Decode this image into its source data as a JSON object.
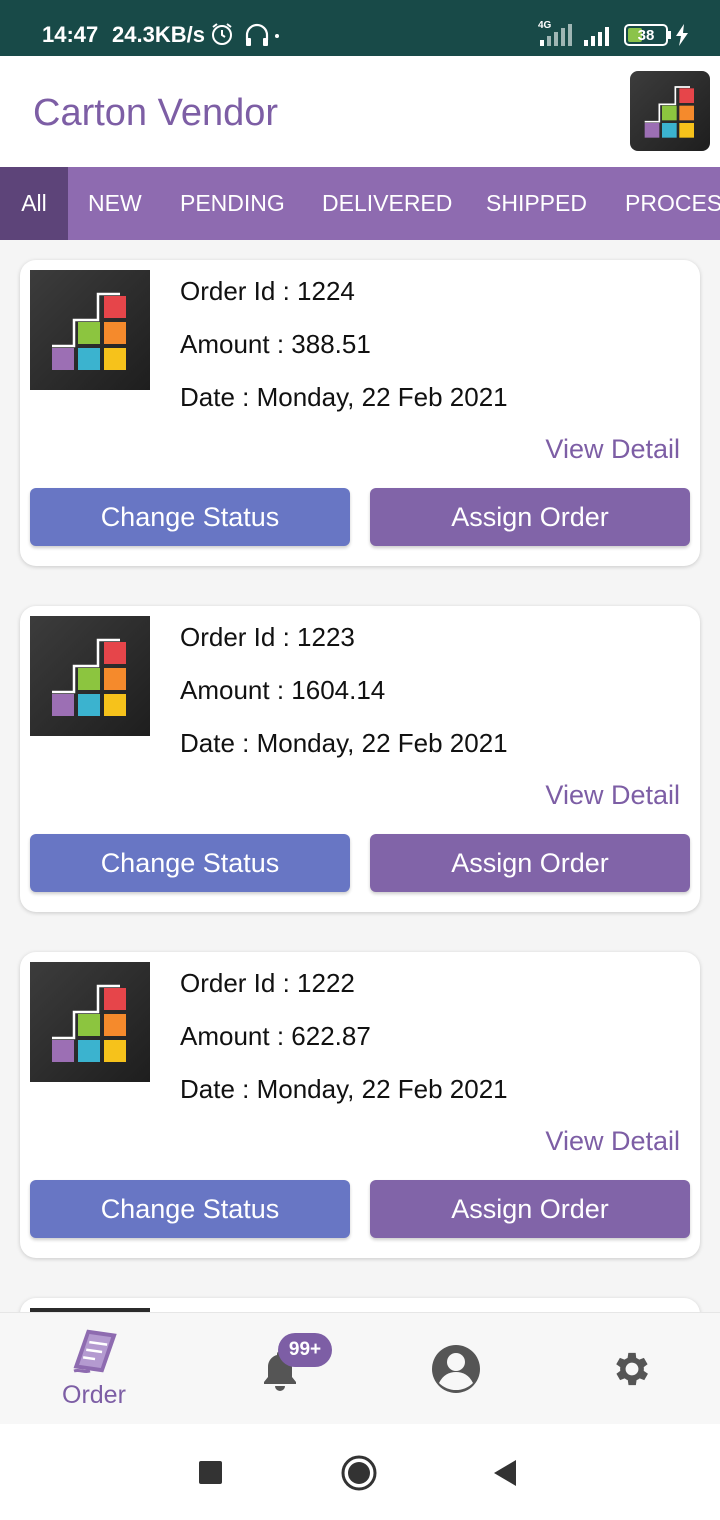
{
  "status_bar": {
    "time": "14:47",
    "net_speed": "24.3KB/s",
    "network_type": "4G",
    "battery_level": "38",
    "icons": [
      "alarm-icon",
      "headset-icon",
      "signal-icon",
      "charging-icon"
    ]
  },
  "app_bar": {
    "title": "Carton Vendor",
    "logo_icon": "carton-logo-icon"
  },
  "tabs": [
    {
      "label": "All",
      "active": true
    },
    {
      "label": "NEW",
      "active": false
    },
    {
      "label": "PENDING",
      "active": false
    },
    {
      "label": "DELIVERED",
      "active": false
    },
    {
      "label": "SHIPPED",
      "active": false
    },
    {
      "label": "PROCESS",
      "active": false
    }
  ],
  "orders": [
    {
      "order_id": "Order Id : 1224",
      "amount": "Amount : 388.51",
      "date": "Date : Monday, 22 Feb 2021",
      "view_detail": "View Detail",
      "change_status": "Change Status",
      "assign_order": "Assign Order"
    },
    {
      "order_id": "Order Id : 1223",
      "amount": "Amount : 1604.14",
      "date": "Date : Monday, 22 Feb 2021",
      "view_detail": "View Detail",
      "change_status": "Change Status",
      "assign_order": "Assign Order"
    },
    {
      "order_id": "Order Id : 1222",
      "amount": "Amount : 622.87",
      "date": "Date : Monday, 22 Feb 2021",
      "view_detail": "View Detail",
      "change_status": "Change Status",
      "assign_order": "Assign Order"
    }
  ],
  "bottom_nav": {
    "order_label": "Order",
    "notification_badge": "99+",
    "icons": [
      "order-icon",
      "bell-icon",
      "profile-icon",
      "gear-icon"
    ]
  },
  "colors": {
    "primary": "#8e6bb0",
    "primary_dark": "#5d4479",
    "title": "#7d5ea5",
    "change_status_button": "#6876c4",
    "assign_order_button": "#8164a8",
    "status_bar": "#184a48"
  }
}
